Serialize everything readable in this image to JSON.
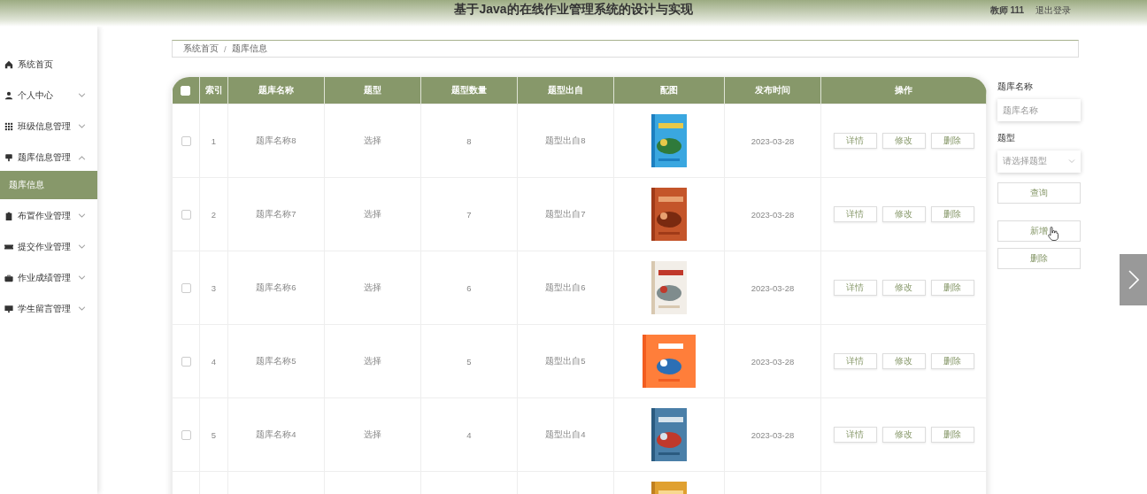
{
  "header": {
    "title": "基于Java的在线作业管理系统的设计与实现",
    "user": "教师 111",
    "logout": "退出登录"
  },
  "sidebar": {
    "items": [
      {
        "label": "系统首页",
        "kind": "link"
      },
      {
        "label": "个人中心",
        "kind": "group",
        "expanded": false
      },
      {
        "label": "班级信息管理",
        "kind": "group",
        "expanded": false
      },
      {
        "label": "题库信息管理",
        "kind": "group",
        "expanded": true,
        "children": [
          {
            "label": "题库信息",
            "selected": true
          }
        ]
      },
      {
        "label": "布置作业管理",
        "kind": "group",
        "expanded": false
      },
      {
        "label": "提交作业管理",
        "kind": "group",
        "expanded": false
      },
      {
        "label": "作业成绩管理",
        "kind": "group",
        "expanded": false
      },
      {
        "label": "学生留言管理",
        "kind": "group",
        "expanded": false
      }
    ]
  },
  "breadcrumb": {
    "items": [
      "系统首页",
      "题库信息"
    ],
    "separator": "/"
  },
  "table": {
    "select_all_checked": false,
    "columns": [
      "索引",
      "题库名称",
      "题型",
      "题型数量",
      "题型出自",
      "配图",
      "发布时间",
      "操作"
    ],
    "rows": [
      {
        "checked": false,
        "index": "1",
        "name": "题库名称8",
        "type": "选择",
        "count": "8",
        "source": "题型出自8",
        "image": {
          "kind": "picture"
        },
        "date": "2023-03-28",
        "actions": [
          "详情",
          "修改",
          "删除"
        ]
      },
      {
        "checked": false,
        "index": "2",
        "name": "题库名称7",
        "type": "选择",
        "count": "7",
        "source": "题型出自7",
        "image": {
          "kind": "picture"
        },
        "date": "2023-03-28",
        "actions": [
          "详情",
          "修改",
          "删除"
        ]
      },
      {
        "checked": false,
        "index": "3",
        "name": "题库名称6",
        "type": "选择",
        "count": "6",
        "source": "题型出自6",
        "image": {
          "kind": "picture"
        },
        "date": "2023-03-28",
        "actions": [
          "详情",
          "修改",
          "删除"
        ]
      },
      {
        "checked": false,
        "index": "4",
        "name": "题库名称5",
        "type": "选择",
        "count": "5",
        "source": "题型出自5",
        "image": {
          "kind": "picture"
        },
        "date": "2023-03-28",
        "actions": [
          "详情",
          "修改",
          "删除"
        ]
      },
      {
        "checked": false,
        "index": "5",
        "name": "题库名称4",
        "type": "选择",
        "count": "4",
        "source": "题型出自4",
        "image": {
          "kind": "picture"
        },
        "date": "2023-03-28",
        "actions": [
          "详情",
          "修改",
          "删除"
        ]
      },
      {
        "image": {
          "kind": "picture"
        }
      }
    ]
  },
  "search": {
    "fields": [
      {
        "label": "题库名称",
        "kind": "input",
        "placeholder": "题库名称"
      },
      {
        "label": "题型",
        "kind": "select",
        "placeholder": "请选择题型"
      }
    ],
    "buttons": [
      "查询",
      "新增",
      "删除"
    ]
  }
}
